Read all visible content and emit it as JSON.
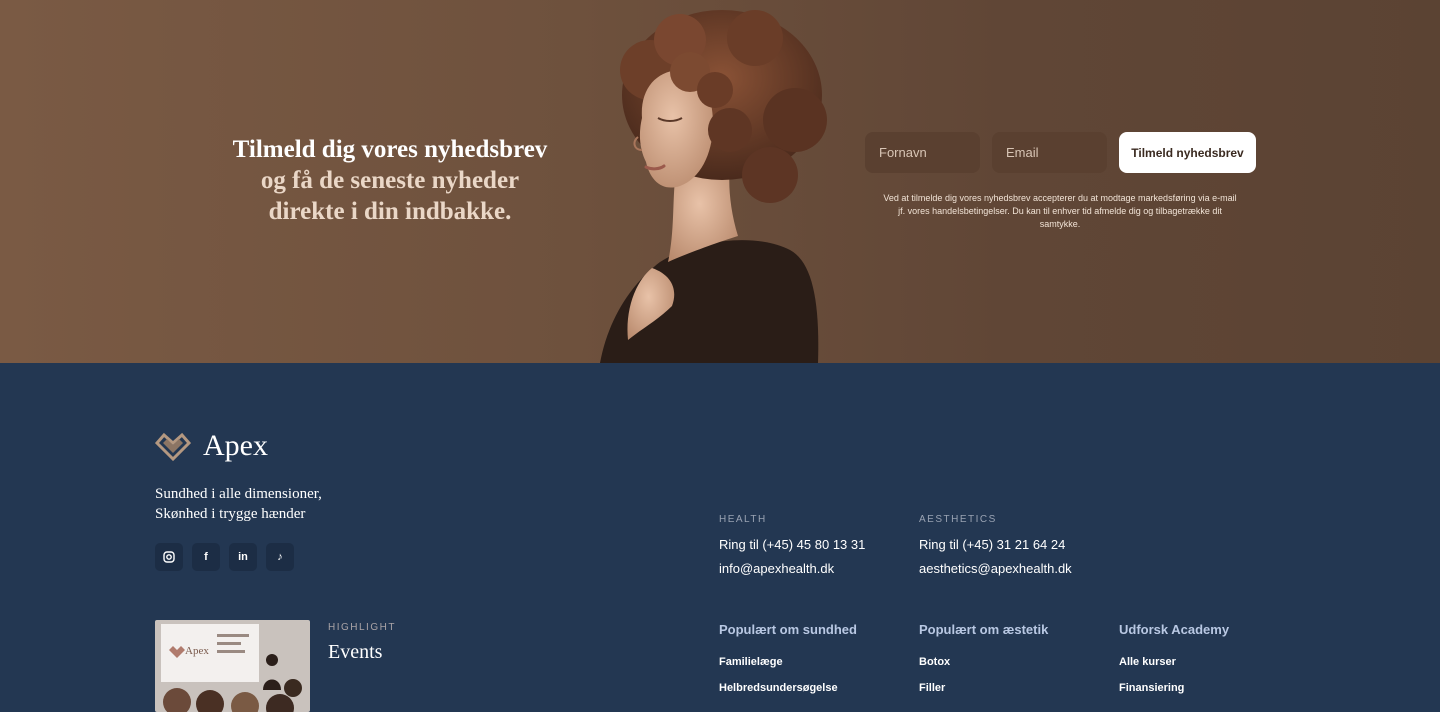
{
  "newsletter": {
    "heading_line1": "Tilmeld dig vores nyhedsbrev",
    "heading_line2": "og få de seneste nyheder",
    "heading_line3": "direkte i din indbakke.",
    "first_name_placeholder": "Fornavn",
    "email_placeholder": "Email",
    "submit_label": "Tilmeld nyhedsbrev",
    "consent_text": "Ved at tilmelde dig vores nyhedsbrev accepterer du at modtage markedsføring via e-mail jf. vores handelsbetingelser. Du kan til enhver tid afmelde dig og tilbagetrække dit samtykke."
  },
  "footer": {
    "logo_text": "Apex",
    "tagline_line1": "Sundhed i alle dimensioner,",
    "tagline_line2": "Skønhed i trygge hænder",
    "socials": [
      {
        "icon": "instagram-icon"
      },
      {
        "icon": "facebook-icon",
        "glyph": "f"
      },
      {
        "icon": "linkedin-icon",
        "glyph": "in"
      },
      {
        "icon": "tiktok-icon",
        "glyph": "♪"
      }
    ],
    "highlight": {
      "eyebrow": "HIGHLIGHT",
      "title": "Events",
      "image_logo_text": "Apex"
    },
    "health": {
      "label": "HEALTH",
      "phone": "Ring til (+45) 45 80 13 31",
      "email": "info@apexhealth.dk"
    },
    "aesthetics": {
      "label": "AESTHETICS",
      "phone": "Ring til (+45) 31 21 64 24",
      "email": "aesthetics@apexhealth.dk"
    },
    "link_columns": [
      {
        "title": "Populært om sundhed",
        "items": [
          "Familielæge",
          "Helbredsundersøgelse"
        ]
      },
      {
        "title": "Populært om æstetik",
        "items": [
          "Botox",
          "Filler"
        ]
      },
      {
        "title": "Udforsk Academy",
        "items": [
          "Alle kurser",
          "Finansiering"
        ]
      }
    ]
  },
  "colors": {
    "hero_brown": "#6e513d",
    "footer_navy": "#233752",
    "field_brown": "#5a4030",
    "link_title_blue": "#b9c8e3"
  }
}
